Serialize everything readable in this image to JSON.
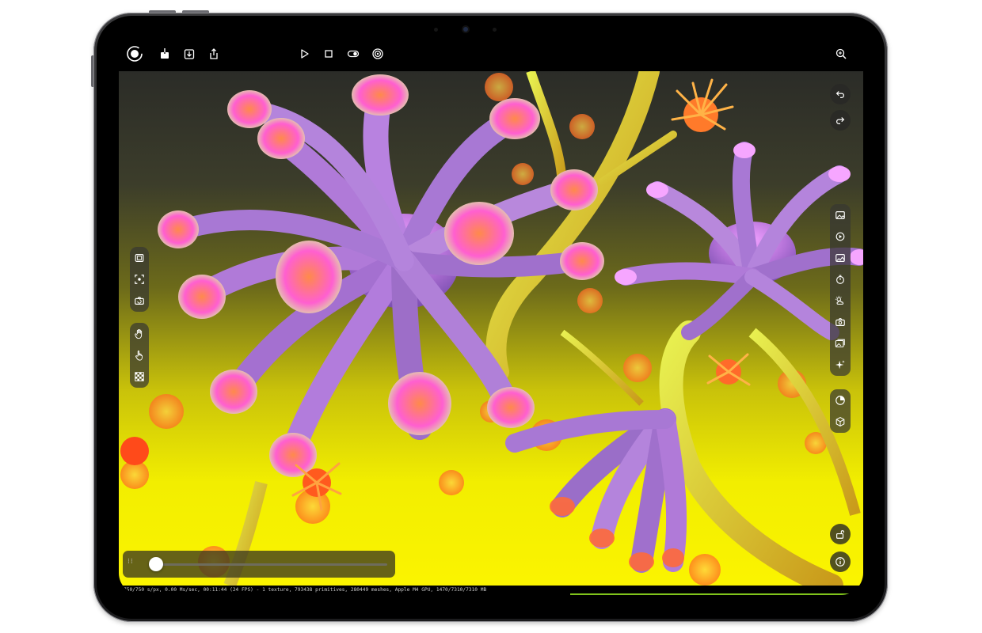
{
  "app": {
    "status_line": "750/750 s/px, 0.00 Ms/sec, 00:11:44 (24 FPS) - 1 texture, 793438 primitives, 280449 meshes, Apple M4 GPU, 1470/7310/7310 MB"
  },
  "toolbar": {
    "left_icons": [
      "record-ring-icon",
      "export-icon",
      "download-icon",
      "share-icon"
    ],
    "center_icons": [
      "play-icon",
      "stop-icon",
      "toggle-icon",
      "target-icon"
    ],
    "right_icons": [
      "zoom-icon"
    ]
  },
  "right_controls": {
    "history": [
      "undo-icon",
      "redo-icon"
    ],
    "panel_main": [
      "image-icon",
      "render-settings-icon",
      "landscape-icon",
      "timer-icon",
      "weather-icon",
      "camera-icon",
      "gallery-icon",
      "sparkle-icon"
    ],
    "panel_secondary": [
      "material-icon",
      "cube-icon"
    ],
    "bottom": [
      "unlock-icon",
      "info-icon"
    ]
  },
  "left_controls": {
    "panel_camera": [
      "frame-icon",
      "focus-icon",
      "camera-rotate-icon"
    ],
    "panel_gesture": [
      "hand-icon",
      "pointer-hand-icon",
      "checker-icon"
    ]
  },
  "timeline": {
    "progress": 0.0
  },
  "colors": {
    "accent": "#7fc31c",
    "panel": "#37372f",
    "background_top": "#2b2c28",
    "background_bottom": "#fbf400"
  }
}
